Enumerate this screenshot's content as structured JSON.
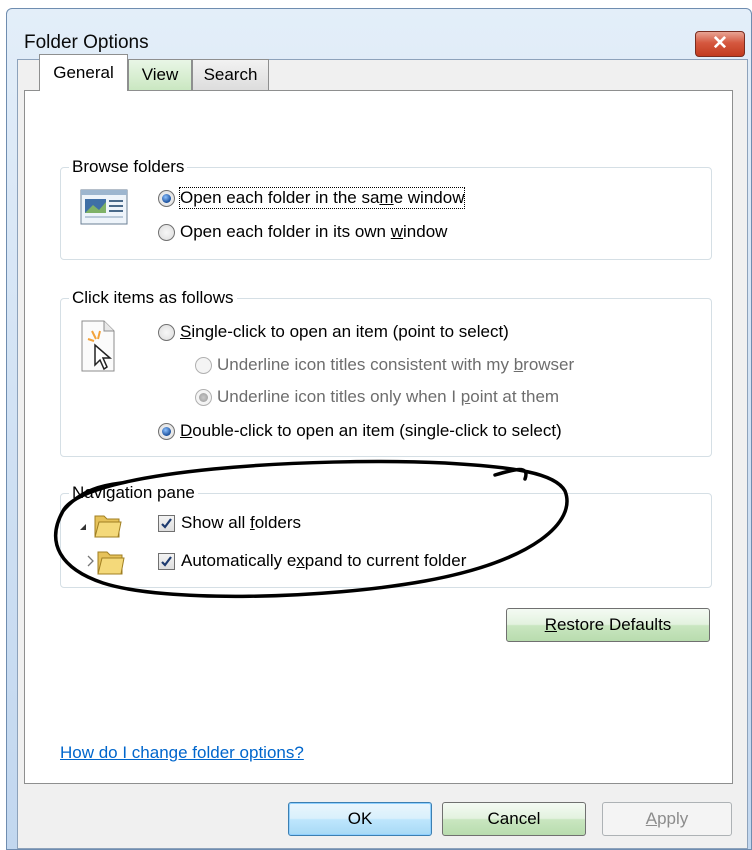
{
  "window": {
    "title": "Folder Options"
  },
  "tabs": [
    {
      "label": "General",
      "active": true
    },
    {
      "label": "View",
      "active": false
    },
    {
      "label": "Search",
      "active": false
    }
  ],
  "browse_folders": {
    "label": "Browse folders",
    "options": [
      {
        "pre": "Open each folder in the sa",
        "ul": "m",
        "post": "e window",
        "checked": true
      },
      {
        "pre": "Open each folder in its own ",
        "ul": "w",
        "post": "indow",
        "checked": false
      }
    ]
  },
  "click_items": {
    "label": "Click items as follows",
    "single": {
      "pre": "",
      "ul": "S",
      "post": "ingle-click to open an item (point to select)",
      "checked": false
    },
    "underline_browser": {
      "pre": "Underline icon titles consistent with my ",
      "ul": "b",
      "post": "rowser",
      "checked": false
    },
    "underline_point": {
      "pre": "Underline icon titles only when I ",
      "ul": "p",
      "post": "oint at them",
      "checked": true
    },
    "double": {
      "pre": "",
      "ul": "D",
      "post": "ouble-click to open an item (single-click to select)",
      "checked": true
    }
  },
  "navigation_pane": {
    "label": "Navigation pane",
    "show_all": {
      "pre": "Show all ",
      "ul": "f",
      "post": "olders",
      "checked": true
    },
    "auto_expand": {
      "pre": "Automatically e",
      "ul": "x",
      "post": "pand to current folder",
      "checked": true
    }
  },
  "restore_defaults": {
    "ul": "R",
    "post": "estore Defaults"
  },
  "help_link": "How do I change folder options?",
  "buttons": {
    "ok": "OK",
    "cancel": "Cancel",
    "apply": {
      "ul": "A",
      "post": "pply"
    }
  }
}
